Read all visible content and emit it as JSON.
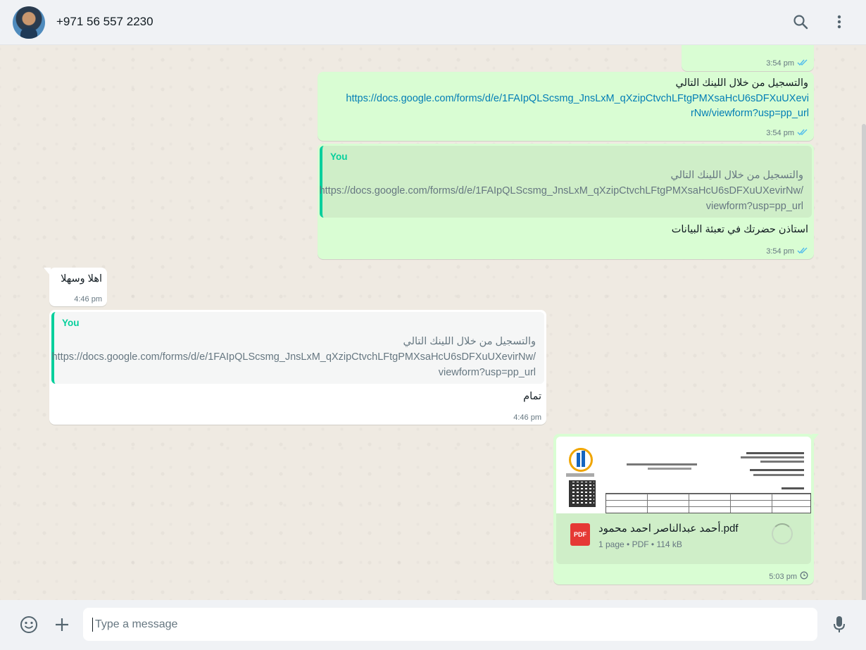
{
  "header": {
    "contact_name": "+971 56 557 2230"
  },
  "messages": {
    "m0": {
      "time": "3:54 pm"
    },
    "m1": {
      "text": "والتسجيل من خلال اللينك التالي",
      "link_line1": "https://docs.google.com/forms/d/e/1FAIpQLScsmg_JnsLxM_qXzipCtvchLFtgPMXsaHcU6sDFXuUXevi",
      "link_line2": "rNw/viewform?usp=pp_url",
      "time": "3:54 pm"
    },
    "m2": {
      "quote_author": "You",
      "quote_line1": "والتسجيل من خلال اللينك التالي",
      "quote_line2": "https://docs.google.com/forms/d/e/1FAIpQLScsmg_JnsLxM_qXzipCtvchLFtgPMXsaHcU6sDFXuUXevirNw/",
      "quote_line3": "viewform?usp=pp_url",
      "text": "استاذن حضرتك في تعبئة البيانات",
      "time": "3:54 pm"
    },
    "m3": {
      "text": "اهلا وسهلا",
      "time": "4:46 pm"
    },
    "m4": {
      "quote_author": "You",
      "quote_line1": "والتسجيل من خلال اللينك التالي",
      "quote_line2": "https://docs.google.com/forms/d/e/1FAIpQLScsmg_JnsLxM_qXzipCtvchLFtgPMXsaHcU6sDFXuUXevirNw/",
      "quote_line3": "viewform?usp=pp_url",
      "text": "تمام",
      "time": "4:46 pm"
    },
    "m5": {
      "doc_name": "أحمد عبدالناصر احمد محمود.pdf",
      "doc_meta": "1 page • PDF • 114 kB",
      "doc_badge": "PDF",
      "time": "5:03 pm"
    }
  },
  "composer": {
    "placeholder": "Type a message"
  },
  "colors": {
    "outgoing": "#d9fdd3",
    "incoming": "#ffffff",
    "accent": "#06cf9c",
    "read_ticks": "#53bdeb",
    "pdf": "#e53935"
  },
  "icons": [
    "search-icon",
    "menu-icon",
    "emoji-icon",
    "plus-icon",
    "mic-icon",
    "double-check-icon",
    "clock-icon",
    "pdf-icon",
    "loading-spinner-icon"
  ]
}
